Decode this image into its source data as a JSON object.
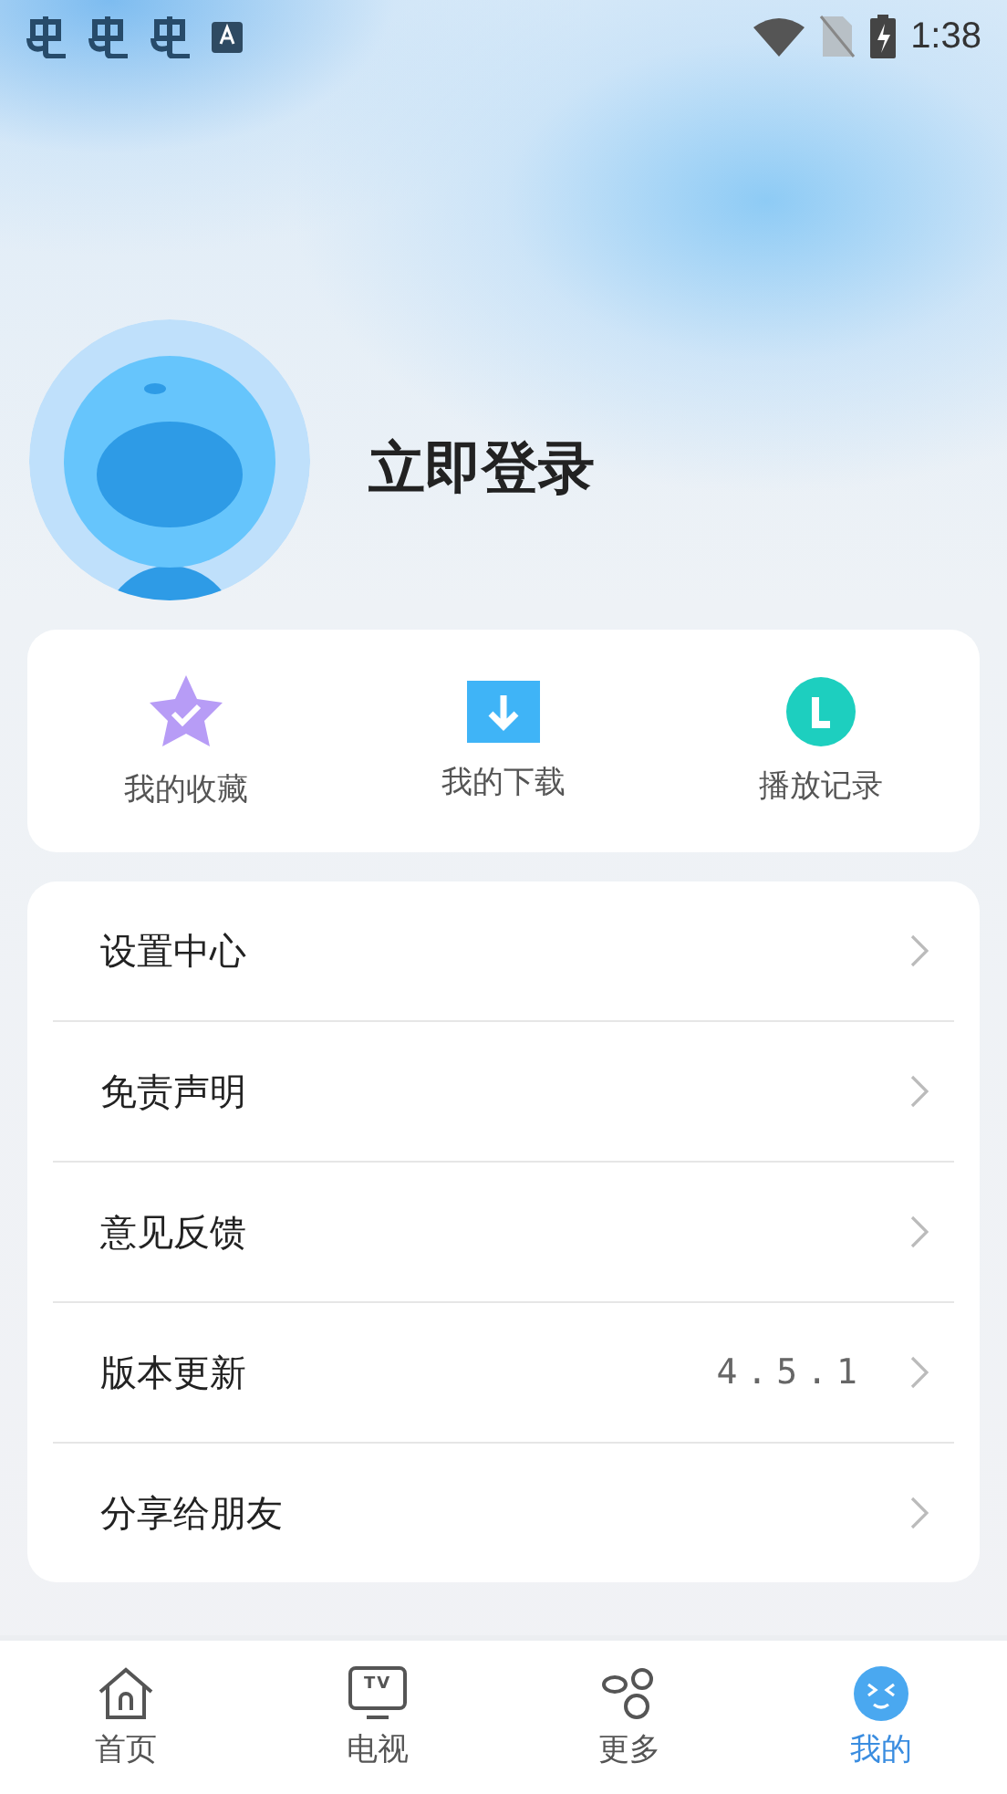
{
  "status_bar": {
    "time": "1:38"
  },
  "profile": {
    "login_label": "立即登录"
  },
  "quick_actions": [
    {
      "kind": "star",
      "label": "我的收藏"
    },
    {
      "kind": "download",
      "label": "我的下载"
    },
    {
      "kind": "history",
      "label": "播放记录"
    }
  ],
  "menu": [
    {
      "label": "设置中心"
    },
    {
      "label": "免责声明"
    },
    {
      "label": "意见反馈"
    },
    {
      "label": "版本更新",
      "value": "4.5.1"
    },
    {
      "label": "分享给朋友"
    }
  ],
  "bottom_nav": [
    {
      "kind": "home",
      "label": "首页",
      "selected": false
    },
    {
      "kind": "tv",
      "label": "电视",
      "icon_text": "TV",
      "selected": false
    },
    {
      "kind": "more",
      "label": "更多",
      "selected": false
    },
    {
      "kind": "mine",
      "label": "我的",
      "selected": true
    }
  ]
}
